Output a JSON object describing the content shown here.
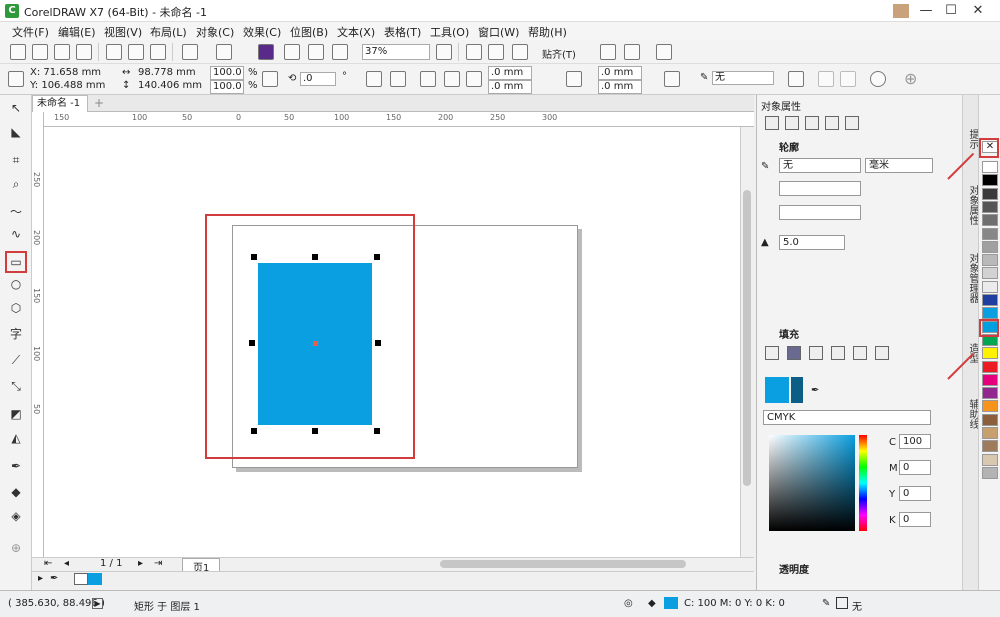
{
  "window": {
    "title": "CorelDRAW X7 (64-Bit) - 未命名 -1",
    "logo": "C"
  },
  "menu": [
    "文件(F)",
    "编辑(E)",
    "视图(V)",
    "布局(L)",
    "对象(C)",
    "效果(C)",
    "位图(B)",
    "文本(X)",
    "表格(T)",
    "工具(O)",
    "窗口(W)",
    "帮助(H)"
  ],
  "toolbar": {
    "zoom": "37%",
    "snap": "贴齐(T)"
  },
  "propbar": {
    "x": "X: 71.658 mm",
    "y": "Y: 106.488 mm",
    "w": "98.778 mm",
    "h": "140.406 mm",
    "sx": "100.0",
    "sy": "100.0",
    "pct": "%",
    "rotate": ".0",
    "deg": "°",
    "corner1": ".0 mm",
    "corner2": ".0 mm",
    "corner3": ".0 mm",
    "corner4": ".0 mm",
    "outline": "无"
  },
  "doc": {
    "tab": "未命名 -1"
  },
  "rulers": {
    "h": [
      "150",
      "100",
      "50",
      "0",
      "50",
      "100",
      "150",
      "200",
      "250",
      "300"
    ],
    "v": [
      "250",
      "200",
      "150",
      "100",
      "50"
    ]
  },
  "nav": {
    "page": "1 / 1",
    "pagetab": "页1"
  },
  "docker": {
    "title": "对象属性",
    "outline_head": "轮廓",
    "outline_width": "无",
    "unit": "毫米",
    "miter": "5.0",
    "fill_head": "填充",
    "model": "CMYK",
    "c_label": "C",
    "c": "100",
    "m_label": "M",
    "m": "0",
    "y_label": "Y",
    "y": "0",
    "k_label": "K",
    "k": "0",
    "transparency_head": "透明度"
  },
  "vtabs": [
    "提示",
    "对象属性",
    "对象管理器",
    "造型",
    "辅助线"
  ],
  "palette": [
    "#ffffff",
    "#000000",
    "#3a3a3a",
    "#555555",
    "#6e6e6e",
    "#878787",
    "#a0a0a0",
    "#b9b9b9",
    "#d2d2d2",
    "#ebebeb",
    "#1f3fa0",
    "#0a9fe0",
    "#00a0e0",
    "#00a651",
    "#fff200",
    "#ed1c24",
    "#e6007e",
    "#92278f",
    "#f7941d",
    "#8b5e3c",
    "#c8a06e",
    "#9e7b5c",
    "#d9c8b0",
    "#b3b3b3"
  ],
  "status": {
    "coords": "( 385.630, 88.496 )",
    "object": "矩形 于 图层 1",
    "fill_info": "C: 100 M: 0 Y: 0 K: 0",
    "outline_info": "无"
  },
  "colors": {
    "fill": "#0a9fe0",
    "highlight": "#d23c3c"
  }
}
